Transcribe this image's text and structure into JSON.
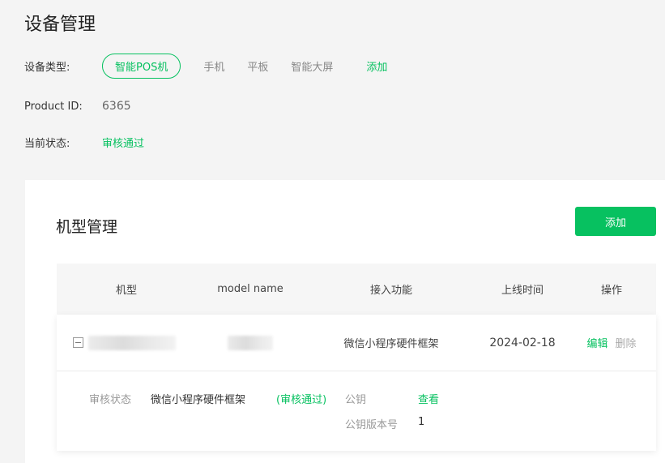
{
  "page": {
    "title": "设备管理"
  },
  "device_type": {
    "label": "设备类型:",
    "selected": "智能POS机",
    "options": [
      "手机",
      "平板",
      "智能大屏"
    ],
    "add_label": "添加"
  },
  "product": {
    "label": "Product ID:",
    "value": "6365"
  },
  "status": {
    "label": "当前状态:",
    "value": "审核通过"
  },
  "models": {
    "title": "机型管理",
    "add_button": "添加",
    "columns": [
      "机型",
      "model name",
      "接入功能",
      "上线时间",
      "操作"
    ],
    "rows": [
      {
        "feature": "微信小程序硬件框架",
        "date": "2024-02-18",
        "edit": "编辑",
        "delete": "删除",
        "detail": {
          "review_label": "审核状态",
          "review_feature": "微信小程序硬件框架",
          "review_status": "(审核通过)",
          "key_label": "公钥",
          "key_action": "查看",
          "key_version_label": "公钥版本号",
          "key_version": "1"
        }
      }
    ]
  },
  "colors": {
    "accent": "#07c160",
    "background": "#f4f4f4"
  }
}
